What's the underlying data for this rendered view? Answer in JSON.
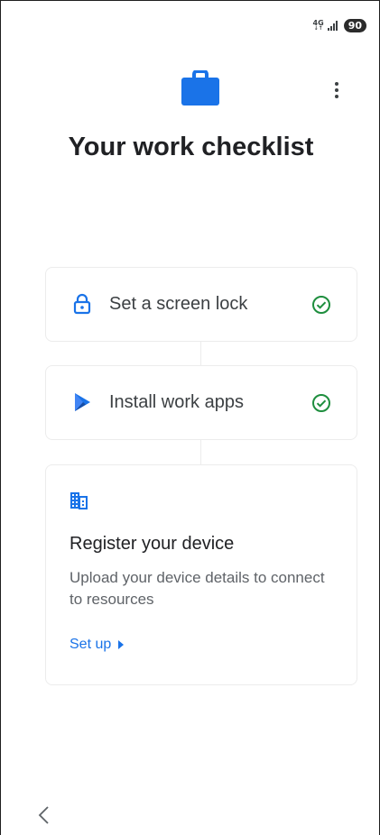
{
  "status_bar": {
    "network": "4G",
    "battery": "90"
  },
  "header": {
    "title": "Your work checklist"
  },
  "steps": [
    {
      "label": "Set a screen lock",
      "status": "complete"
    },
    {
      "label": "Install work apps",
      "status": "complete"
    }
  ],
  "register": {
    "title": "Register your device",
    "description": "Upload your device details to connect to resources",
    "action_label": "Set up"
  },
  "colors": {
    "accent_blue": "#1a73e8",
    "success_green": "#1e8e3e",
    "title_text": "#202124"
  },
  "icons": {
    "header": "briefcase-icon",
    "menu": "more-vert-icon",
    "step1": "lock-icon",
    "step2": "play-store-icon",
    "check": "check-circle-icon",
    "register": "building-icon",
    "nav_back": "chevron-left-icon"
  }
}
